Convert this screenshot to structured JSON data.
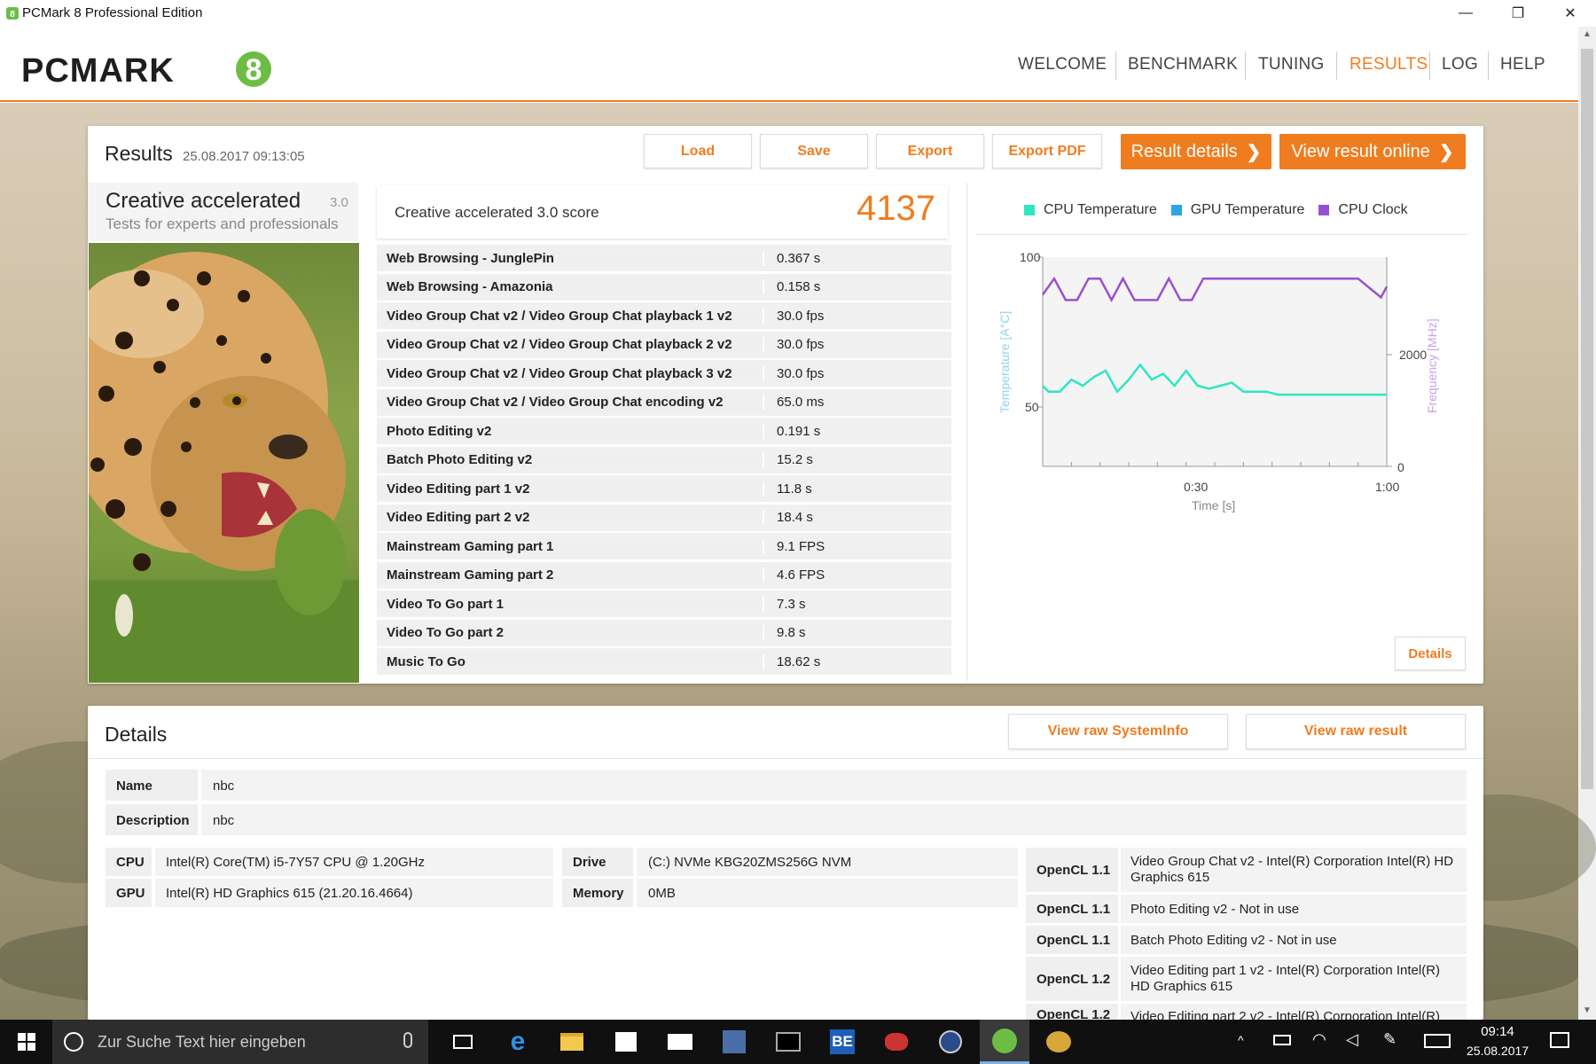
{
  "window": {
    "title": "PCMark 8 Professional Edition",
    "minimize": "—",
    "restore": "❐",
    "close": "✕"
  },
  "nav": {
    "logo": "PCMARK",
    "logo_num": "8",
    "items": [
      "WELCOME",
      "BENCHMARK",
      "TUNING",
      "RESULTS",
      "LOG",
      "HELP"
    ],
    "active": "RESULTS"
  },
  "results": {
    "title": "Results",
    "date": "25.08.2017 09:13:05",
    "buttons": {
      "load": "Load",
      "save": "Save",
      "export": "Export",
      "export_pdf": "Export PDF",
      "result_details": "Result details",
      "view_online": "View result online"
    },
    "test_name": "Creative accelerated",
    "test_version": "3.0",
    "test_subtitle": "Tests for experts and professionals",
    "score_label": "Creative accelerated 3.0 score",
    "score": "4137",
    "rows": [
      {
        "name": "Web Browsing - JunglePin",
        "value": "0.367 s"
      },
      {
        "name": "Web Browsing - Amazonia",
        "value": "0.158 s"
      },
      {
        "name": "Video Group Chat v2 / Video Group Chat playback 1 v2",
        "value": "30.0 fps"
      },
      {
        "name": "Video Group Chat v2 / Video Group Chat playback 2 v2",
        "value": "30.0 fps"
      },
      {
        "name": "Video Group Chat v2 / Video Group Chat playback 3 v2",
        "value": "30.0 fps"
      },
      {
        "name": "Video Group Chat v2 / Video Group Chat encoding v2",
        "value": "65.0 ms"
      },
      {
        "name": "Photo Editing v2",
        "value": "0.191 s"
      },
      {
        "name": "Batch Photo Editing v2",
        "value": "15.2 s"
      },
      {
        "name": "Video Editing part 1 v2",
        "value": "11.8 s"
      },
      {
        "name": "Video Editing part 2 v2",
        "value": "18.4 s"
      },
      {
        "name": "Mainstream Gaming part 1",
        "value": "9.1 FPS"
      },
      {
        "name": "Mainstream Gaming part 2",
        "value": "4.6 FPS"
      },
      {
        "name": "Video To Go part 1",
        "value": "7.3 s"
      },
      {
        "name": "Video To Go part 2",
        "value": "9.8 s"
      },
      {
        "name": "Music To Go",
        "value": "18.62 s"
      }
    ],
    "details_button": "Details"
  },
  "chart_data": {
    "type": "line",
    "legend": [
      {
        "name": "CPU Temperature",
        "color": "#2ee6c2"
      },
      {
        "name": "GPU Temperature",
        "color": "#2aa6e0"
      },
      {
        "name": "CPU Clock",
        "color": "#9a4fd0"
      }
    ],
    "xlabel": "Time [s]",
    "ylabel_left": "Temperature [A°C]",
    "ylabel_right": "Frequency [MHz]",
    "x_ticks": [
      "0:30",
      "1:00"
    ],
    "y_left_ticks": [
      "100",
      "50"
    ],
    "y_right_ticks": [
      "2000",
      "0"
    ],
    "xlim": [
      0,
      60
    ],
    "ylim_left": [
      30,
      100
    ],
    "ylim_right": [
      0,
      3900
    ],
    "series": [
      {
        "name": "CPU Temperature",
        "axis": "left",
        "color": "#2ee6c2",
        "x": [
          0,
          1,
          3,
          5,
          7,
          9,
          11,
          13,
          15,
          17,
          19,
          21,
          23,
          25,
          27,
          29,
          31,
          33,
          35,
          37,
          39,
          41,
          43,
          45,
          47,
          49,
          51,
          53,
          55,
          57,
          59,
          60
        ],
        "y": [
          57,
          55,
          55,
          59,
          57,
          60,
          62,
          55,
          59,
          64,
          59,
          61,
          57,
          62,
          57,
          56,
          57,
          58,
          55,
          55,
          55,
          54,
          54,
          54,
          54,
          54,
          54,
          54,
          54,
          54,
          54,
          54
        ]
      },
      {
        "name": "CPU Clock",
        "axis": "right",
        "color": "#9a4fd0",
        "x": [
          0,
          2,
          4,
          6,
          8,
          10,
          12,
          14,
          16,
          18,
          20,
          22,
          24,
          26,
          28,
          30,
          35,
          40,
          45,
          50,
          55,
          59,
          60
        ],
        "y": [
          3200,
          3500,
          3100,
          3100,
          3500,
          3500,
          3100,
          3500,
          3100,
          3100,
          3100,
          3500,
          3100,
          3100,
          3500,
          3500,
          3500,
          3500,
          3500,
          3500,
          3500,
          3150,
          3350
        ]
      }
    ]
  },
  "details": {
    "title": "Details",
    "buttons": {
      "raw_sysinfo": "View raw SystemInfo",
      "raw_result": "View raw result"
    },
    "name_label": "Name",
    "name_value": "nbc",
    "desc_label": "Description",
    "desc_value": "nbc",
    "cpu_label": "CPU",
    "cpu_value": "Intel(R) Core(TM) i5-7Y57 CPU @ 1.20GHz",
    "gpu_label": "GPU",
    "gpu_value": "Intel(R) HD Graphics 615 (21.20.16.4664)",
    "drive_label": "Drive",
    "drive_value": "(C:) NVMe KBG20ZMS256G NVM",
    "memory_label": "Memory",
    "memory_value": "0MB",
    "opencl": [
      {
        "label": "OpenCL 1.1",
        "value": "Video Group Chat v2 - Intel(R) Corporation Intel(R) HD Graphics 615"
      },
      {
        "label": "OpenCL 1.1",
        "value": "Photo Editing v2 - Not in use"
      },
      {
        "label": "OpenCL 1.1",
        "value": "Batch Photo Editing v2 - Not in use"
      },
      {
        "label": "OpenCL 1.2",
        "value": "Video Editing part 1 v2 - Intel(R) Corporation Intel(R) HD Graphics 615"
      },
      {
        "label": "OpenCL 1.2",
        "value": "Video Editing part 2 v2 - Intel(R) Corporation Intel(R)"
      }
    ]
  },
  "taskbar": {
    "search_placeholder": "Zur Suche Text hier eingeben",
    "time": "09:14",
    "date": "25.08.2017",
    "be_label": "BE"
  }
}
